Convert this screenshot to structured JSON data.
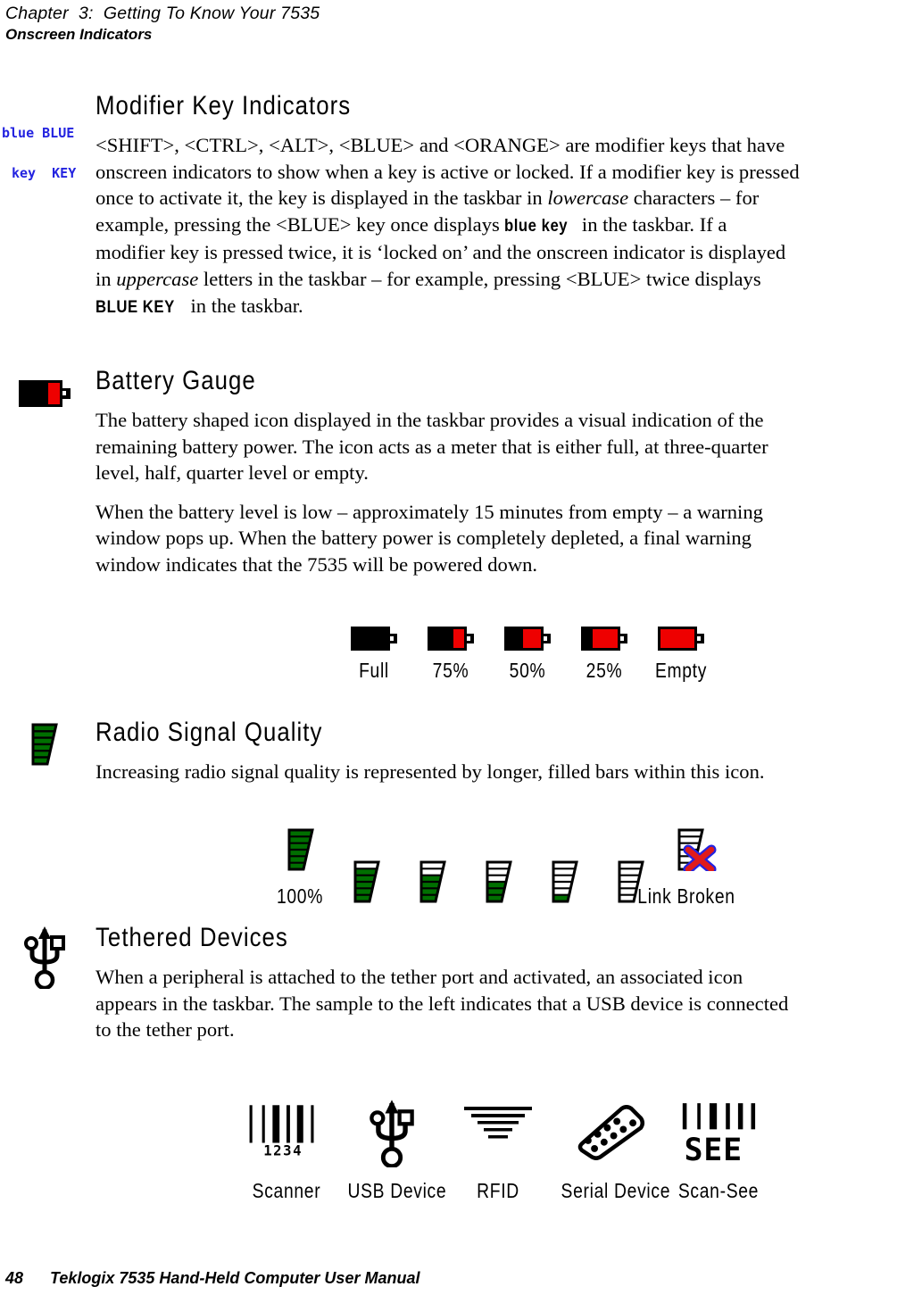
{
  "runhead": {
    "chapter": "Chapter  3:  Getting To Know Your 7535",
    "section": "Onscreen Indicators"
  },
  "footer": {
    "page_number": "48",
    "manual_title": "Teklogix 7535 Hand-Held Computer User Manual"
  },
  "sections": {
    "modifier": {
      "heading": "Modifier Key Indicators",
      "margin_icon": {
        "name": "blue-key-indicator-icon",
        "line1": "blue BLUE",
        "line2": "key  KEY",
        "color": "#2323e0"
      },
      "paragraph": {
        "p1": "<SHIFT>, <CTRL>, <ALT>, <BLUE> and <ORANGE> are modifier keys that have onscreen indicators to show when a key is active or locked. If a modifier key is pressed once to activate it, the key is displayed in the taskbar in ",
        "em1": "lowercase",
        "p2": " characters – for example, pressing the <BLUE> key once displays ",
        "kbd1": "blue key",
        "p3": " in the taskbar. If a modifier key is pressed twice, it is ‘locked on’ and the onscreen indicator is displayed in ",
        "em2": "uppercase",
        "p4": " letters in the taskbar – for example, pressing <BLUE> twice displays ",
        "kbd2": "BLUE KEY",
        "p5": " in the taskbar."
      }
    },
    "battery": {
      "heading": "Battery Gauge",
      "margin_icon": "battery-icon",
      "p1": "The battery shaped icon displayed in the taskbar provides a visual indication of the remaining battery power. The icon acts as a meter that is either full, at three-quarter level, half, quarter level or empty.",
      "p2": "When the battery level is low – approximately 15 minutes from empty – a warning window pops up. When the battery power is completely depleted, a final warning window indicates that the 7535 will be powered down.",
      "gauges": [
        {
          "label": "Full",
          "empty_pct": 0
        },
        {
          "label": "75%",
          "empty_pct": 28
        },
        {
          "label": "50%",
          "empty_pct": 45
        },
        {
          "label": "25%",
          "empty_pct": 63
        },
        {
          "label": "Empty",
          "empty_pct": 100
        }
      ],
      "fill_color": "#ee0000",
      "body_color": "#000000"
    },
    "radio": {
      "heading": "Radio Signal Quality",
      "margin_icon": "radio-signal-icon",
      "p1": "Increasing radio signal quality is represented by longer, filled bars within this icon.",
      "bar_color": "#006f00",
      "icons": [
        {
          "filled_bars": 6,
          "label": "100%",
          "broken": false
        },
        {
          "filled_bars": 5,
          "label": "",
          "broken": false
        },
        {
          "filled_bars": 4,
          "label": "",
          "broken": false
        },
        {
          "filled_bars": 3,
          "label": "",
          "broken": false
        },
        {
          "filled_bars": 1,
          "label": "",
          "broken": false
        },
        {
          "filled_bars": 0,
          "label": "",
          "broken": false
        },
        {
          "filled_bars": 0,
          "label": "Link Broken",
          "broken": true
        }
      ],
      "broken_x_colors": {
        "stroke": "#e01b1b",
        "shadow": "#2323e0"
      }
    },
    "tethered": {
      "heading": "Tethered Devices",
      "margin_icon": "usb-icon",
      "p1": "When a peripheral is attached to the tether port and activated, an associated icon appears in the taskbar. The sample to the left indicates that a USB device is connected to the tether port.",
      "devices": [
        {
          "icon": "barcode-scanner-icon",
          "label": "Scanner",
          "barcode_digits": "1234"
        },
        {
          "icon": "usb-icon",
          "label": "USB Device",
          "barcode_digits": ""
        },
        {
          "icon": "rfid-icon",
          "label": "RFID",
          "barcode_digits": ""
        },
        {
          "icon": "serial-connector-icon",
          "label": "Serial Device",
          "barcode_digits": ""
        },
        {
          "icon": "scan-see-icon",
          "label": "Scan-See",
          "barcode_digits": "SEE"
        }
      ]
    }
  }
}
